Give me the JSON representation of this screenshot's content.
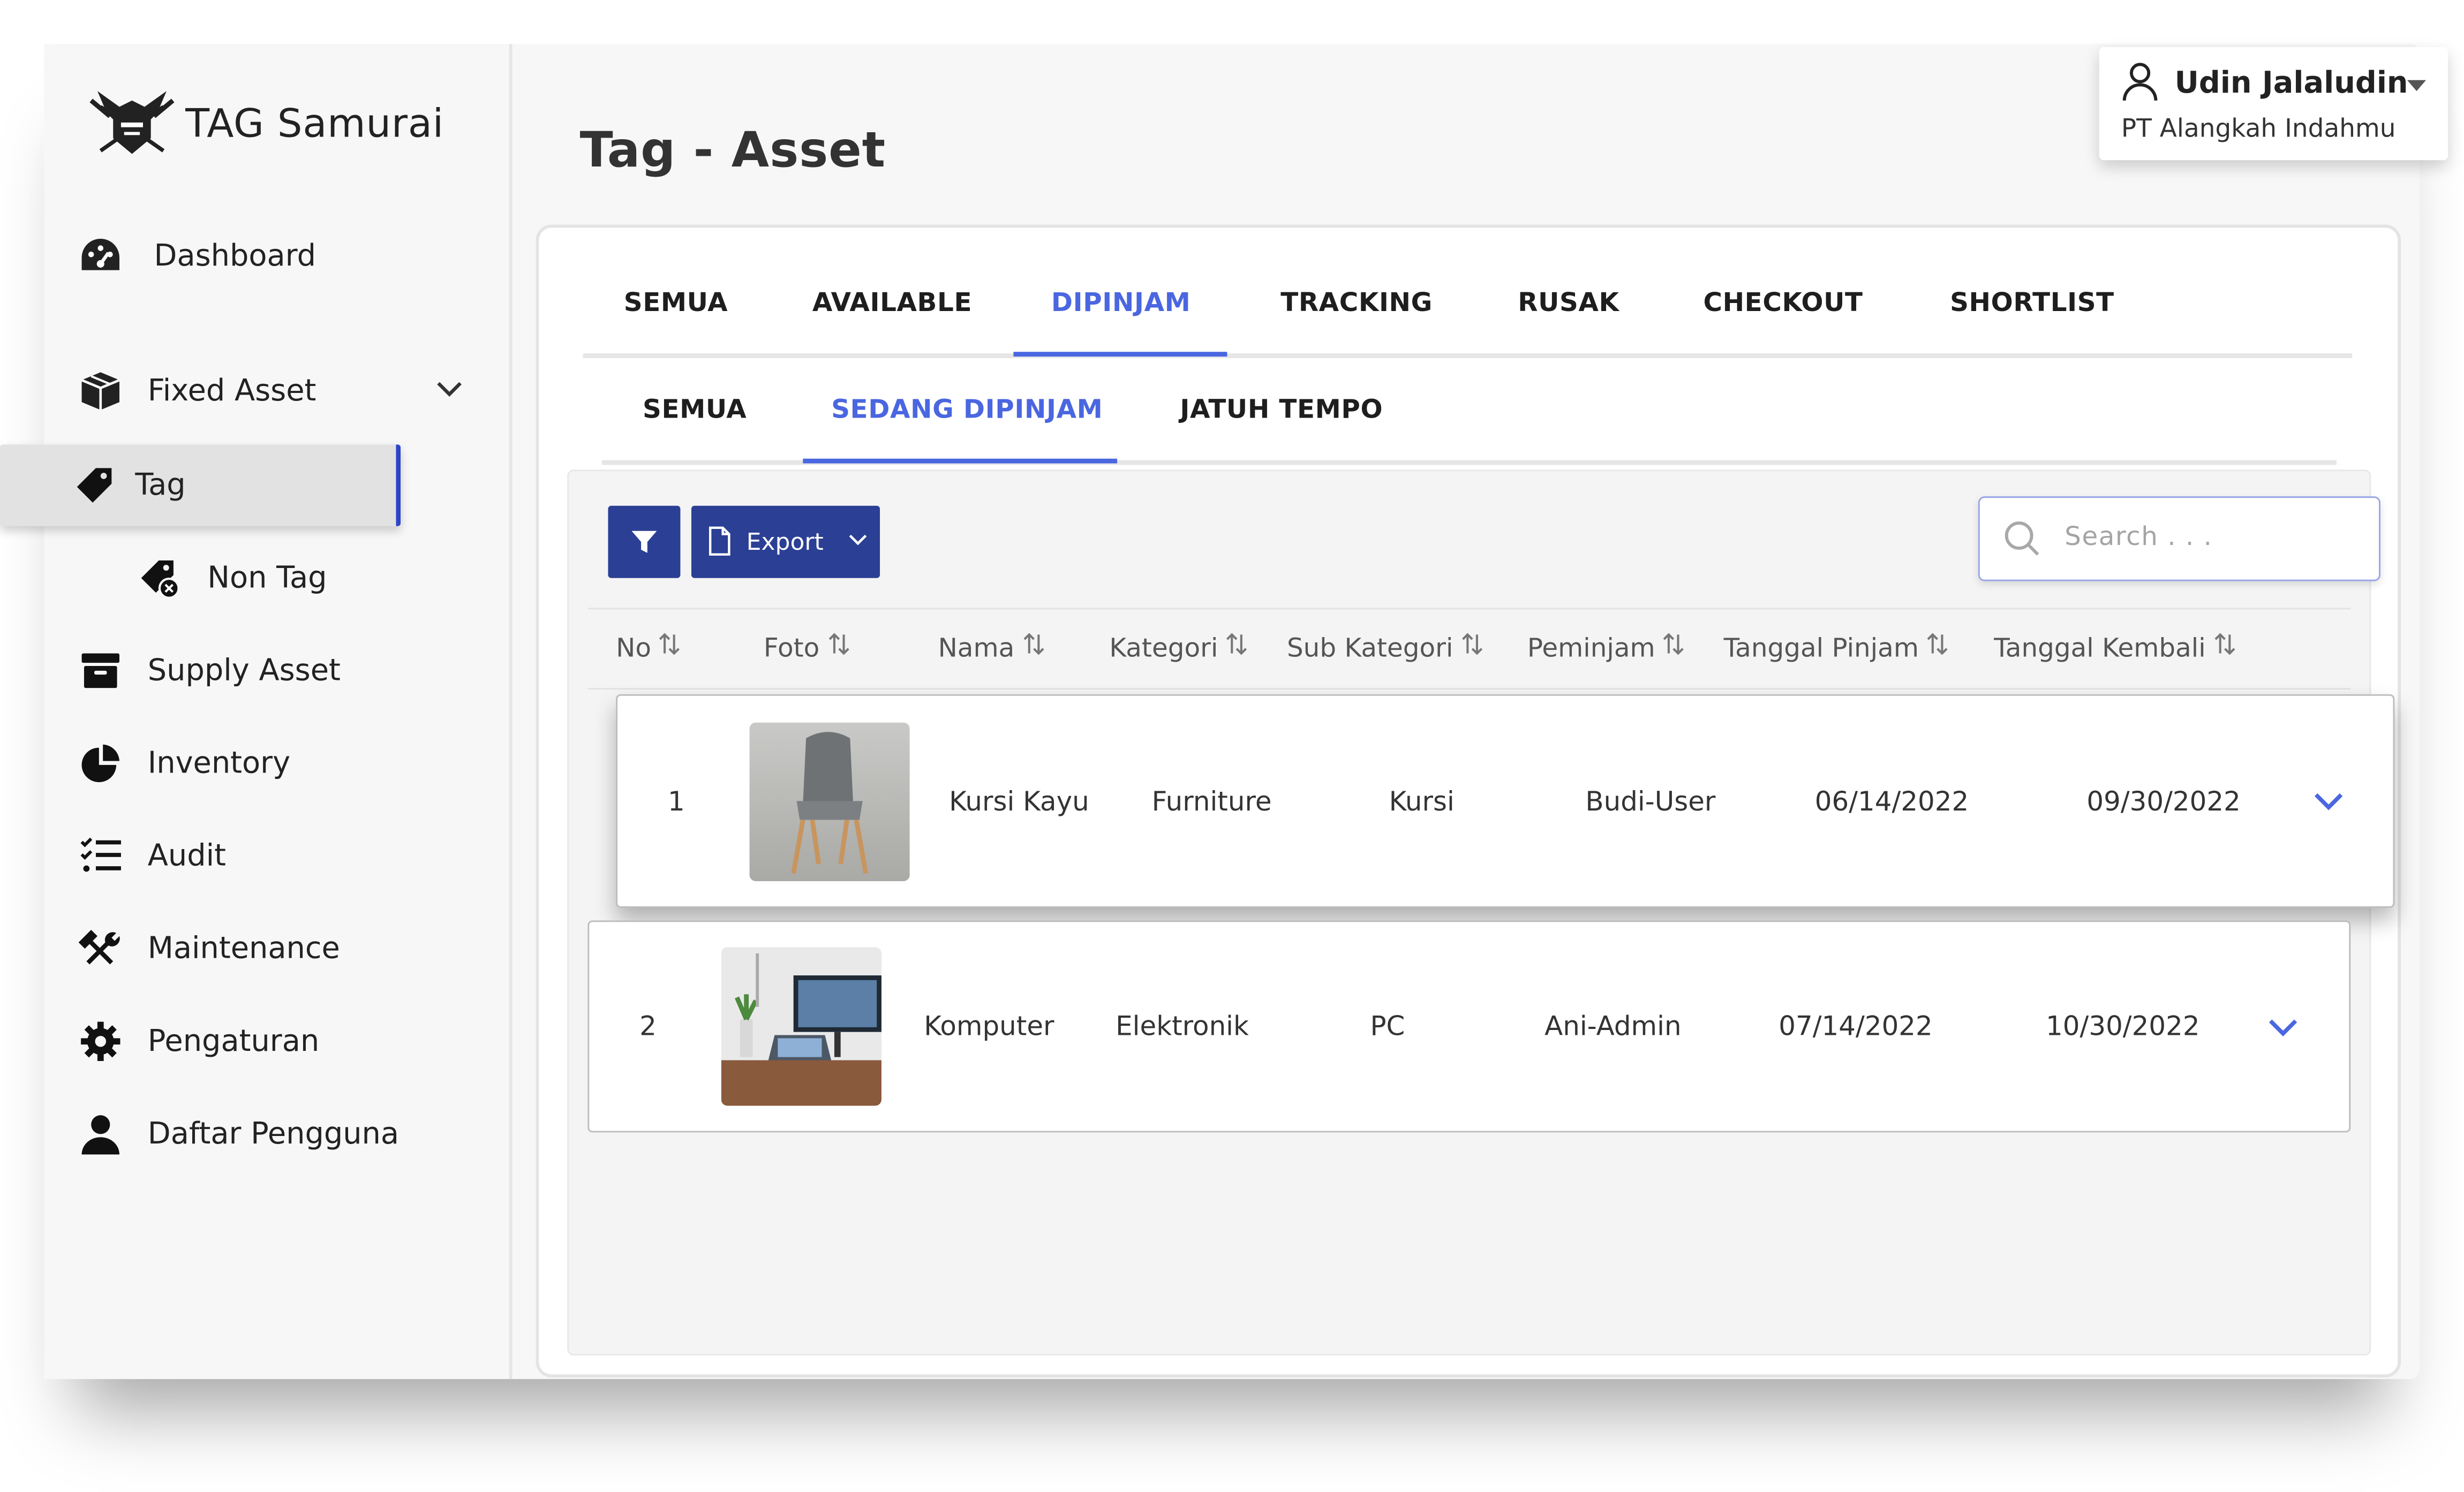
{
  "app": {
    "logo_text": "TAG Samurai"
  },
  "sidebar": {
    "items": [
      {
        "label": "Dashboard",
        "icon": "dashboard-gauge-icon"
      },
      {
        "label": "Fixed Asset",
        "icon": "cube-box-icon"
      },
      {
        "label": "Tag",
        "icon": "tag-icon"
      },
      {
        "label": "Non Tag",
        "icon": "tag-off-icon"
      },
      {
        "label": "Supply Asset",
        "icon": "archive-icon"
      },
      {
        "label": "Inventory",
        "icon": "pie-chart-icon"
      },
      {
        "label": "Audit",
        "icon": "checklist-icon"
      },
      {
        "label": "Maintenance",
        "icon": "tools-icon"
      },
      {
        "label": "Pengaturan",
        "icon": "gear-icon"
      },
      {
        "label": "Daftar Pengguna",
        "icon": "user-icon"
      }
    ]
  },
  "header": {
    "title": "Tag - Asset"
  },
  "user": {
    "name": "Udin Jalaludin",
    "company": "PT Alangkah Indahmu"
  },
  "tabs": {
    "main": [
      "SEMUA",
      "AVAILABLE",
      "DIPINJAM",
      "TRACKING",
      "RUSAK",
      "CHECKOUT",
      "SHORTLIST"
    ],
    "main_active": "DIPINJAM",
    "sub": [
      "SEMUA",
      "SEDANG DIPINJAM",
      "JATUH TEMPO"
    ],
    "sub_active": "SEDANG DIPINJAM"
  },
  "toolbar": {
    "export_label": "Export",
    "search_placeholder": "Search . . ."
  },
  "table": {
    "columns": [
      "No",
      "Foto",
      "Nama",
      "Kategori",
      "Sub Kategori",
      "Peminjam",
      "Tanggal Pinjam",
      "Tanggal Kembali"
    ],
    "rows": [
      {
        "no": "1",
        "foto": "chair-photo",
        "nama": "Kursi Kayu",
        "kategori": "Furniture",
        "sub_kategori": "Kursi",
        "peminjam": "Budi-User",
        "tanggal_pinjam": "06/14/2022",
        "tanggal_kembali": "09/30/2022"
      },
      {
        "no": "2",
        "foto": "desk-computer-photo",
        "nama": "Komputer",
        "kategori": "Elektronik",
        "sub_kategori": "PC",
        "peminjam": "Ani-Admin",
        "tanggal_pinjam": "07/14/2022",
        "tanggal_kembali": "10/30/2022"
      }
    ]
  },
  "colors": {
    "accent": "#4a66e0",
    "button": "#2b3f94",
    "sidebar_active_bg": "#e2e2e2"
  }
}
